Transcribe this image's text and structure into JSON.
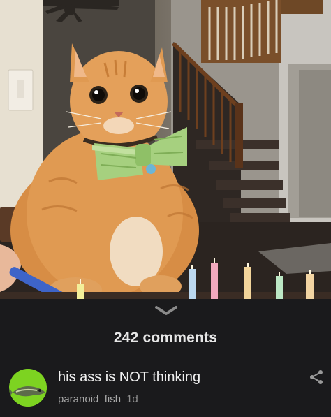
{
  "post": {
    "image_alt_subject": "cat with green bow tie at birthday candles"
  },
  "comments_header": {
    "count_label": "242 comments",
    "expand_icon": "chevron-down-icon"
  },
  "comment": {
    "text": "his ass is NOT thinking",
    "username": "paranoid_fish",
    "age": "1d",
    "share_icon": "share-icon",
    "avatar_icon": "fish-avatar-icon"
  },
  "colors": {
    "background": "#1a1a1c",
    "text_primary": "#f0f0f0",
    "text_secondary": "#a8a8a8",
    "avatar_bg": "#7dd321"
  }
}
